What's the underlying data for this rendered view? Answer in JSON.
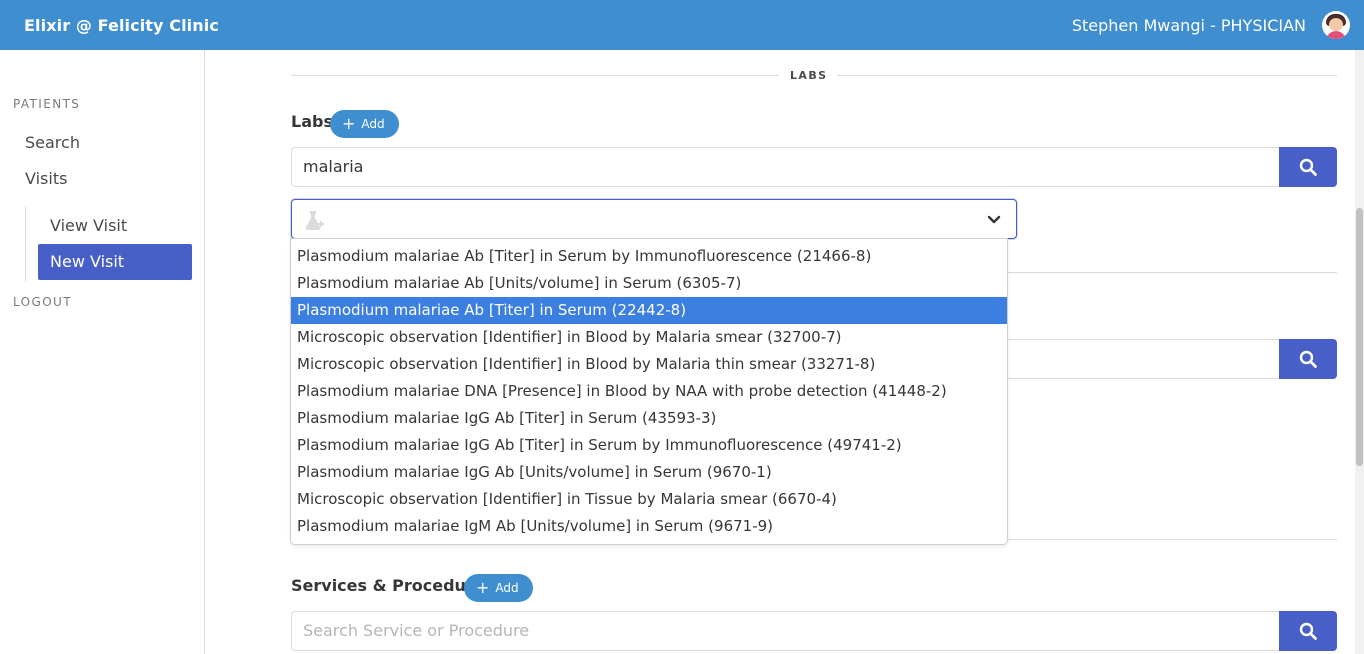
{
  "header": {
    "brand": "Elixir @ Felicity Clinic",
    "user": "Stephen Mwangi - PHYSICIAN"
  },
  "sidebar": {
    "patients_label": "PATIENTS",
    "search": "Search",
    "visits": "Visits",
    "view_visit": "View Visit",
    "new_visit": "New Visit",
    "logout": "LOGOUT"
  },
  "labs_section": {
    "divider_title": "LABS",
    "label": "Labs",
    "add_label": "Add",
    "search_value": "malaria"
  },
  "dropdown": {
    "selected_index": 2,
    "options": [
      "Plasmodium malariae Ab [Titer] in Serum by Immunofluorescence (21466-8)",
      "Plasmodium malariae Ab [Units/volume] in Serum (6305-7)",
      "Plasmodium malariae Ab [Titer] in Serum (22442-8)",
      "Microscopic observation [Identifier] in Blood by Malaria smear (32700-7)",
      "Microscopic observation [Identifier] in Blood by Malaria thin smear (33271-8)",
      "Plasmodium malariae DNA [Presence] in Blood by NAA with probe detection (41448-2)",
      "Plasmodium malariae IgG Ab [Titer] in Serum (43593-3)",
      "Plasmodium malariae IgG Ab [Titer] in Serum by Immunofluorescence (49741-2)",
      "Plasmodium malariae IgG Ab [Units/volume] in Serum (9670-1)",
      "Microscopic observation [Identifier] in Tissue by Malaria smear (6670-4)",
      "Plasmodium malariae IgM Ab [Units/volume] in Serum (9671-9)"
    ]
  },
  "services_section": {
    "label": "Services & Procedures",
    "add_label": "Add",
    "placeholder": "Search Service or Procedure"
  },
  "colors": {
    "topbar": "#3e8ed0",
    "primary": "#485fc7",
    "selected_option": "#3b7fe0"
  }
}
